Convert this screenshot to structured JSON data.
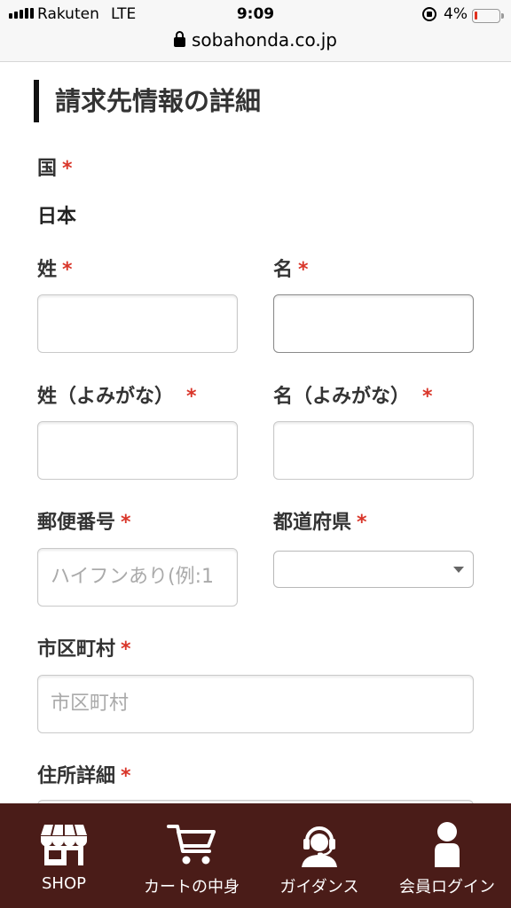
{
  "status_bar": {
    "carrier": "Rakuten",
    "network": "LTE",
    "time": "9:09",
    "battery": "4%",
    "url": "sobahonda.co.jp"
  },
  "form": {
    "title": "請求先情報の詳細",
    "required_mark": "*",
    "country": {
      "label": "国",
      "value": "日本"
    },
    "last_name": {
      "label": "姓",
      "value": ""
    },
    "first_name": {
      "label": "名",
      "value": ""
    },
    "last_name_kana": {
      "label": "姓（よみがな）",
      "value": ""
    },
    "first_name_kana": {
      "label": "名（よみがな）",
      "value": ""
    },
    "postal_code": {
      "label": "郵便番号",
      "placeholder": "ハイフンあり(例:1"
    },
    "prefecture": {
      "label": "都道府県",
      "selected": ""
    },
    "city": {
      "label": "市区町村",
      "placeholder": "市区町村"
    },
    "address": {
      "label": "住所詳細"
    }
  },
  "bottom_nav": {
    "items": [
      {
        "label": "SHOP",
        "icon": "shop-icon"
      },
      {
        "label": "カートの中身",
        "icon": "cart-icon"
      },
      {
        "label": "ガイダンス",
        "icon": "operator-icon"
      },
      {
        "label": "会員ログイン",
        "icon": "user-icon"
      }
    ]
  },
  "colors": {
    "nav_background": "#4a1c18",
    "required": "#d9362a"
  }
}
